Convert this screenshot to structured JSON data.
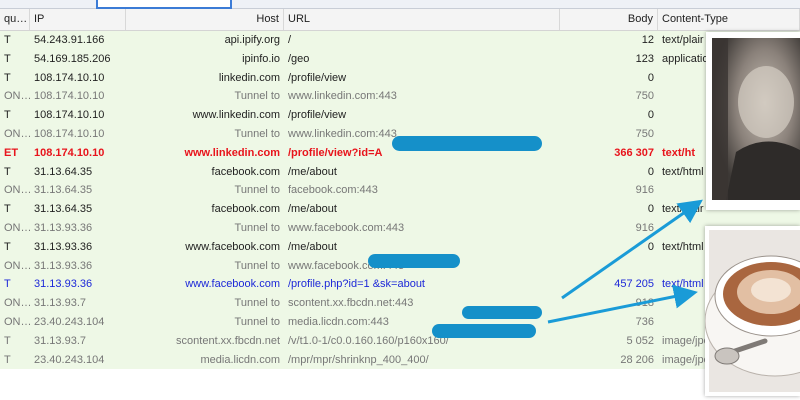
{
  "columns": {
    "method": "qu…",
    "ip": "IP",
    "host": "Host",
    "url": "URL",
    "body": "Body",
    "content_type": "Content-Type"
  },
  "rows": [
    {
      "method": "T",
      "ip": "54.243.91.166",
      "host": "api.ipify.org",
      "url": "/",
      "body": "12",
      "ct": "text/plair",
      "style": "normal"
    },
    {
      "method": "T",
      "ip": "54.169.185.206",
      "host": "ipinfo.io",
      "url": "/geo",
      "body": "123",
      "ct": "applicatio",
      "style": "normal"
    },
    {
      "method": "T",
      "ip": "108.174.10.10",
      "host": "linkedin.com",
      "url": "/profile/view",
      "body": "0",
      "ct": "",
      "style": "normal"
    },
    {
      "method": "ON…",
      "ip": "108.174.10.10",
      "host": "Tunnel to",
      "url": "www.linkedin.com:443",
      "body": "750",
      "ct": "",
      "style": "tunnel"
    },
    {
      "method": "T",
      "ip": "108.174.10.10",
      "host": "www.linkedin.com",
      "url": "/profile/view",
      "body": "0",
      "ct": "",
      "style": "normal"
    },
    {
      "method": "ON…",
      "ip": "108.174.10.10",
      "host": "Tunnel to",
      "url": "www.linkedin.com:443",
      "body": "750",
      "ct": "",
      "style": "tunnel"
    },
    {
      "method": "ET",
      "ip": "108.174.10.10",
      "host": "www.linkedin.com",
      "url": "/profile/view?id=A",
      "body": "366 307",
      "ct": "text/ht",
      "style": "red"
    },
    {
      "method": "T",
      "ip": "31.13.64.35",
      "host": "facebook.com",
      "url": "/me/about",
      "body": "0",
      "ct": "text/html",
      "style": "normal"
    },
    {
      "method": "ON…",
      "ip": "31.13.64.35",
      "host": "Tunnel to",
      "url": "facebook.com:443",
      "body": "916",
      "ct": "",
      "style": "tunnel"
    },
    {
      "method": "T",
      "ip": "31.13.64.35",
      "host": "facebook.com",
      "url": "/me/about",
      "body": "0",
      "ct": "text/plair",
      "style": "normal"
    },
    {
      "method": "ON…",
      "ip": "31.13.93.36",
      "host": "Tunnel to",
      "url": "www.facebook.com:443",
      "body": "916",
      "ct": "",
      "style": "tunnel"
    },
    {
      "method": "T",
      "ip": "31.13.93.36",
      "host": "www.facebook.com",
      "url": "/me/about",
      "body": "0",
      "ct": "text/html",
      "style": "normal"
    },
    {
      "method": "ON…",
      "ip": "31.13.93.36",
      "host": "Tunnel to",
      "url": "www.facebook.com:443",
      "body": "",
      "ct": "",
      "style": "tunnel"
    },
    {
      "method": "T",
      "ip": "31.13.93.36",
      "host": "www.facebook.com",
      "url": "/profile.php?id=1                          &sk=about",
      "body": "457 205",
      "ct": "text/html",
      "style": "blue"
    },
    {
      "method": "ON…",
      "ip": "31.13.93.7",
      "host": "Tunnel to",
      "url": "scontent.xx.fbcdn.net:443",
      "body": "918",
      "ct": "",
      "style": "tunnel"
    },
    {
      "method": "ON…",
      "ip": "23.40.243.104",
      "host": "Tunnel to",
      "url": "media.licdn.com:443",
      "body": "736",
      "ct": "",
      "style": "tunnel"
    },
    {
      "method": "T",
      "ip": "31.13.93.7",
      "host": "scontent.xx.fbcdn.net",
      "url": "/v/t1.0-1/c0.0.160.160/p160x160/",
      "body": "5 052",
      "ct": "image/jpe",
      "style": "tunnel"
    },
    {
      "method": "T",
      "ip": "23.40.243.104",
      "host": "media.licdn.com",
      "url": "/mpr/mpr/shrinknp_400_400/",
      "body": "28 206",
      "ct": "image/jpe",
      "style": "tunnel"
    }
  ],
  "colors": {
    "row_bg": "#eef8e6",
    "highlight_red": "#e8141c",
    "highlight_blue": "#1d28d8",
    "redaction": "#1590c9",
    "arrow": "#1a9bd7"
  }
}
